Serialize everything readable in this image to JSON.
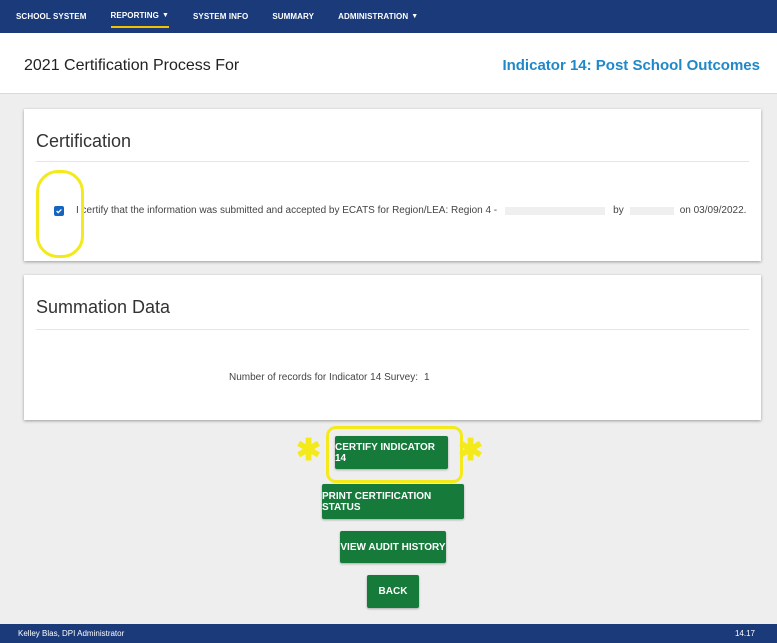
{
  "nav": {
    "items": [
      {
        "label": "SCHOOL SYSTEM",
        "dropdown": false
      },
      {
        "label": "REPORTING",
        "dropdown": true
      },
      {
        "label": "SYSTEM INFO",
        "dropdown": false
      },
      {
        "label": "SUMMARY",
        "dropdown": false
      },
      {
        "label": "ADMINISTRATION",
        "dropdown": true
      }
    ],
    "active": "REPORTING"
  },
  "header": {
    "title": "2021 Certification Process For",
    "indicator": "Indicator 14: Post School Outcomes"
  },
  "certification": {
    "title": "Certification",
    "checked": true,
    "text_before": "I certify that the information was submitted and accepted by ECATS for Region/LEA: Region 4 -",
    "text_by": "by",
    "text_date": "on 03/09/2022."
  },
  "summation": {
    "title": "Summation Data",
    "records_label": "Number of records for Indicator 14 Survey:",
    "records_value": "1"
  },
  "buttons": {
    "certify": "CERTIFY INDICATOR 14",
    "print": "PRINT CERTIFICATION STATUS",
    "audit": "VIEW AUDIT HISTORY",
    "back": "BACK"
  },
  "footer": {
    "user": "Kelley Blas, DPI Administrator",
    "version": "14.17"
  },
  "colors": {
    "nav_bg": "#1b3a7a",
    "nav_active_underline": "#f2c200",
    "indicator_link": "#1e88c8",
    "button_green": "#157a3a",
    "annotation_yellow": "#f4ea1b"
  }
}
